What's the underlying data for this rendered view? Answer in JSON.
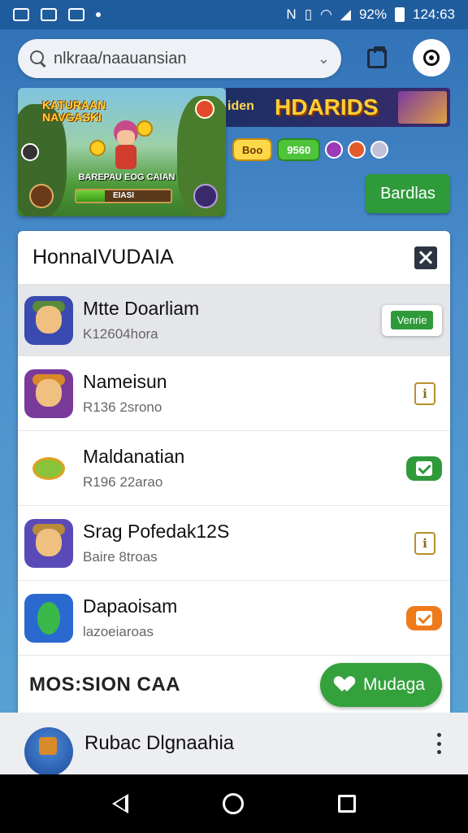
{
  "status_bar": {
    "battery": "92%",
    "time": "124:63"
  },
  "search": {
    "value": "nlkraa/naauansian",
    "placeholder": "nlkraa/naauansian"
  },
  "banner": {
    "title": "KATURAAN NAVGASKI",
    "caption": "BAREPAU EOG CAIAN",
    "progress_label": "EIASI",
    "progress_fraction": 0.3
  },
  "ad": {
    "left_text": "iden",
    "title": "HDARIDS",
    "pill_yellow": "Boo",
    "pill_green": "9560"
  },
  "bardlas_button": "Bardlas",
  "panel": {
    "title": "HonnaIVUDAIA",
    "items": [
      {
        "title": "Mtte Doarliam",
        "subtitle": "K12604hora",
        "action": "Venrie",
        "icon_color": "#3a4ab0"
      },
      {
        "title": "Nameisun",
        "subtitle": "R136 2srono",
        "action": "i",
        "icon_color": "#7a3a9a"
      },
      {
        "title": "Maldanatian",
        "subtitle": "R196 22arao",
        "action": "check-green",
        "icon_color": "#ffffff"
      },
      {
        "title": "Srag Pofedak12S",
        "subtitle": "Baire 8troas",
        "action": "i",
        "icon_color": "#5a4ab8"
      },
      {
        "title": "Dapaoisam",
        "subtitle": "lazoeiaroas",
        "action": "check-orange",
        "icon_color": "#2a6ad0"
      }
    ],
    "footer_label": "MOS:SION CAA",
    "footer_button": "Mudaga"
  },
  "bottom_item": {
    "title": "Rubac Dlgnaahia"
  },
  "colors": {
    "accent_green": "#2f9a3a",
    "accent_orange": "#ef7a1a",
    "background_blue": "#3f7fc0"
  }
}
